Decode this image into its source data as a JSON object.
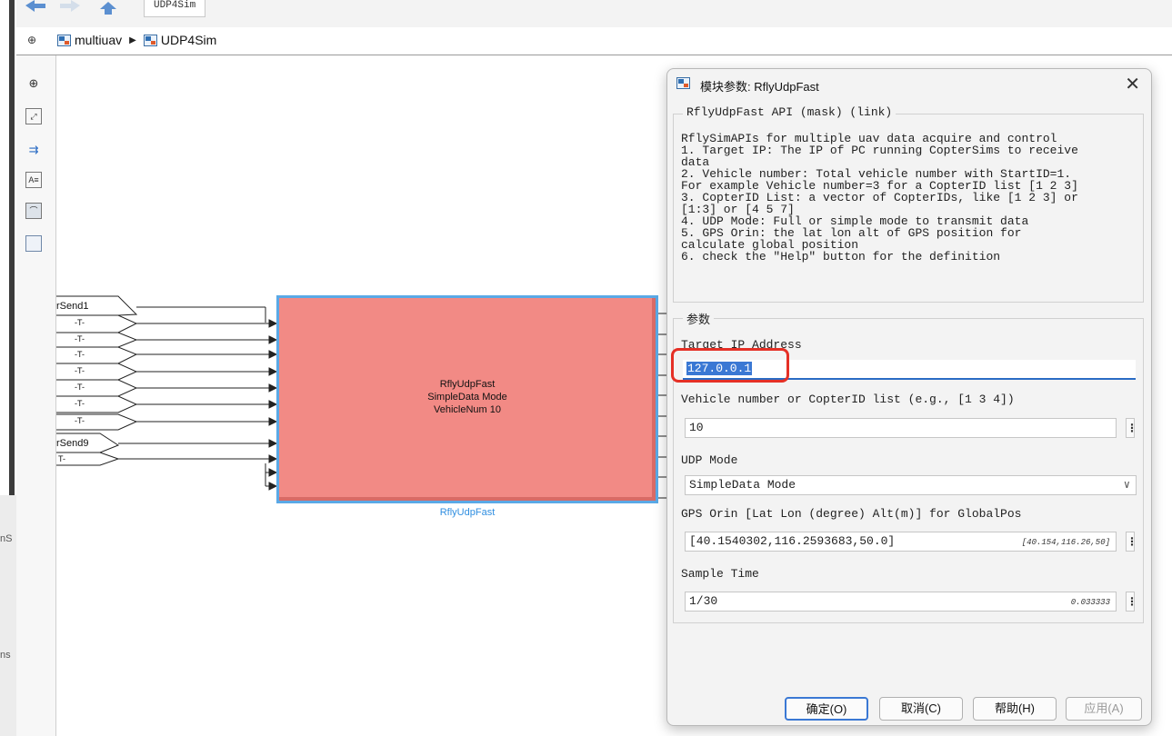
{
  "window": {
    "tab_label": "UDP4Sim",
    "left_strip_labels": [
      "nS",
      "ns"
    ]
  },
  "breadcrumb": {
    "items": [
      {
        "label": "multiuav",
        "icon": "model-icon"
      },
      {
        "label": "UDP4Sim",
        "icon": "subsystem-icon"
      }
    ],
    "expand_icon": "collapse-expand-icon"
  },
  "palette": {
    "tools": [
      "zoom-icon",
      "fit-to-view-icon",
      "signal-arrow-icon",
      "annotation-icon",
      "image-icon",
      "area-icon"
    ]
  },
  "canvas": {
    "inputs": [
      {
        "label": "rSend1"
      },
      {
        "label": "-T-"
      },
      {
        "label": "-T-"
      },
      {
        "label": "-T-"
      },
      {
        "label": "-T-"
      },
      {
        "label": "-T-"
      },
      {
        "label": "-T-"
      },
      {
        "label": "-T-"
      },
      {
        "label": "rSend9"
      },
      {
        "label": "T-"
      }
    ],
    "block": {
      "line1": "RflyUdpFast",
      "line2": "SimpleData Mode",
      "line3": "VehicleNum 10",
      "name": "RflyUdpFast",
      "fill_color": "#f28a85",
      "border_color": "#5aa9e6"
    }
  },
  "dialog": {
    "title": "模块参数: RflyUdpFast",
    "close_icon": "close-icon",
    "group_title": "RflyUdpFast API (mask) (link)",
    "description": "RflySimAPIs for multiple uav data acquire and control\n1. Target IP: The IP of PC running CopterSims to receive\ndata\n2. Vehicle number: Total vehicle number with StartID=1.\nFor example Vehicle number=3 for a CopterID list [1 2 3]\n3. CopterID List: a vector of CopterIDs, like [1 2 3] or\n[1:3] or [4 5 7]\n4. UDP Mode: Full or simple mode to transmit data\n5. GPS Orin: the lat lon alt of GPS position for\ncalculate global position\n6. check the \"Help\" button for the definition",
    "params_title": "参数",
    "params": {
      "target_ip_label": "Target IP Address",
      "target_ip_value": "127.0.0.1",
      "vehicle_label": "Vehicle number or CopterID list (e.g., [1 3 4])",
      "vehicle_value": "10",
      "udp_mode_label": "UDP Mode",
      "udp_mode_value": "SimpleData Mode",
      "gps_label": "GPS Orin [Lat Lon (degree) Alt(m)] for GlobalPos",
      "gps_value": "[40.1540302,116.2593683,50.0]",
      "gps_hint": "[40.154,116.26,50]",
      "sample_label": "Sample Time",
      "sample_value": "1/30",
      "sample_hint": "0.033333"
    },
    "buttons": {
      "ok": "确定(O)",
      "cancel": "取消(C)",
      "help": "帮助(H)",
      "apply": "应用(A)"
    },
    "highlight_color": "#e53026",
    "accent_color": "#3a78d4"
  }
}
